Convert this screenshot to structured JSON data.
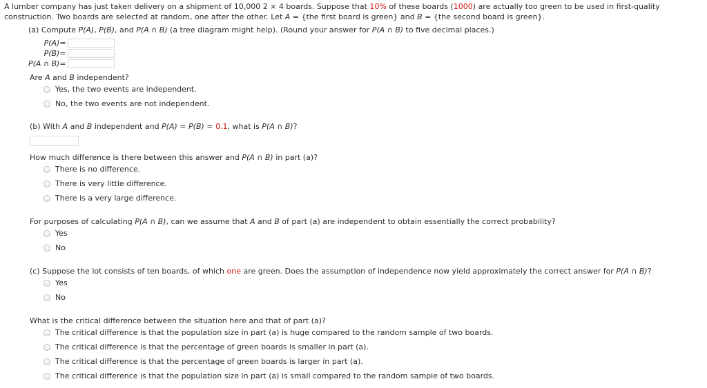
{
  "problem": {
    "line1_a": "A lumber company has just taken delivery on a shipment of 10,000 2 ",
    "line1_times": "×",
    "line1_b": " 4 boards. Suppose that ",
    "pct_green": "10%",
    "line1_c": " of these boards (",
    "count_green": "1000",
    "line1_d": ") are actually too green to be used in first-quality construction. Two boards are selected at random, one after the other. Let ",
    "var_A": "A",
    "line1_e": " = {the first board is green} and ",
    "var_B": "B",
    "line1_f": " = {the second board is green}."
  },
  "part_a": {
    "prompt_1": "(a) Compute ",
    "pa": "P(A)",
    "prompt_2": ", ",
    "pb": "P(B)",
    "prompt_3": ", and ",
    "pab": "P(A ∩ B)",
    "prompt_4": " (a tree diagram might help). (Round your answer for ",
    "pab2": "P(A ∩ B)",
    "prompt_5": " to five decimal places.)",
    "fields": [
      {
        "label": "P(A)",
        "eq": "=",
        "value": "",
        "name": "p-a-field"
      },
      {
        "label": "P(B)",
        "eq": "=",
        "value": "",
        "name": "p-b-field"
      },
      {
        "label": "P(A ∩ B)",
        "eq": "=",
        "value": "",
        "name": "p-a-int-b-field"
      }
    ]
  },
  "independence_question": {
    "title_1": "Are ",
    "title_A": "A",
    "title_2": " and ",
    "title_B": "B",
    "title_3": " independent?",
    "options": [
      "Yes, the two events are independent.",
      "No, the two events are not independent."
    ]
  },
  "part_b": {
    "prompt_1": "(b) With ",
    "A": "A",
    "prompt_2": " and ",
    "B": "B",
    "prompt_3": " independent and ",
    "pa": "P(A)",
    "eq1": " = ",
    "pb": "P(B)",
    "eq2": " = ",
    "value_red": "0.1",
    "prompt_4": ", what is ",
    "pab": "P(A ∩ B)",
    "prompt_5": "?",
    "answer_value": ""
  },
  "difference_question": {
    "title_1": "How much difference is there between this answer and ",
    "pab": "P(A ∩ B)",
    "title_2": " in part (a)?",
    "options": [
      "There is no difference.",
      "There is very little difference.",
      "There is a very large difference."
    ]
  },
  "assume_question": {
    "title_1": "For purposes of calculating ",
    "pab": "P(A ∩ B)",
    "title_2": ", can we assume that ",
    "A": "A",
    "title_3": " and ",
    "B": "B",
    "title_4": " of part (a) are independent to obtain essentially the correct probability?",
    "options": [
      "Yes",
      "No"
    ]
  },
  "part_c": {
    "prompt_1": "(c) Suppose the lot consists of ten boards, of which ",
    "count_red": "one",
    "prompt_2": " are green. Does the assumption of independence now yield approximately the correct answer for ",
    "pab": "P(A ∩ B)",
    "prompt_3": "?",
    "options": [
      "Yes",
      "No"
    ]
  },
  "critical_question": {
    "title": "What is the critical difference between the situation here and that of part (a)?",
    "options": [
      "The critical difference is that the population size in part (a) is huge compared to the random sample of two boards.",
      "The critical difference is that the percentage of green boards is smaller in part (a).",
      "The critical difference is that the percentage of green boards is larger in part (a).",
      "The critical difference is that the population size in part (a) is small compared to the random sample of two boards."
    ]
  },
  "colors": {
    "accent_red": "#d01414",
    "text": "#2b2b2b",
    "field_border": "#d6d6d6"
  }
}
